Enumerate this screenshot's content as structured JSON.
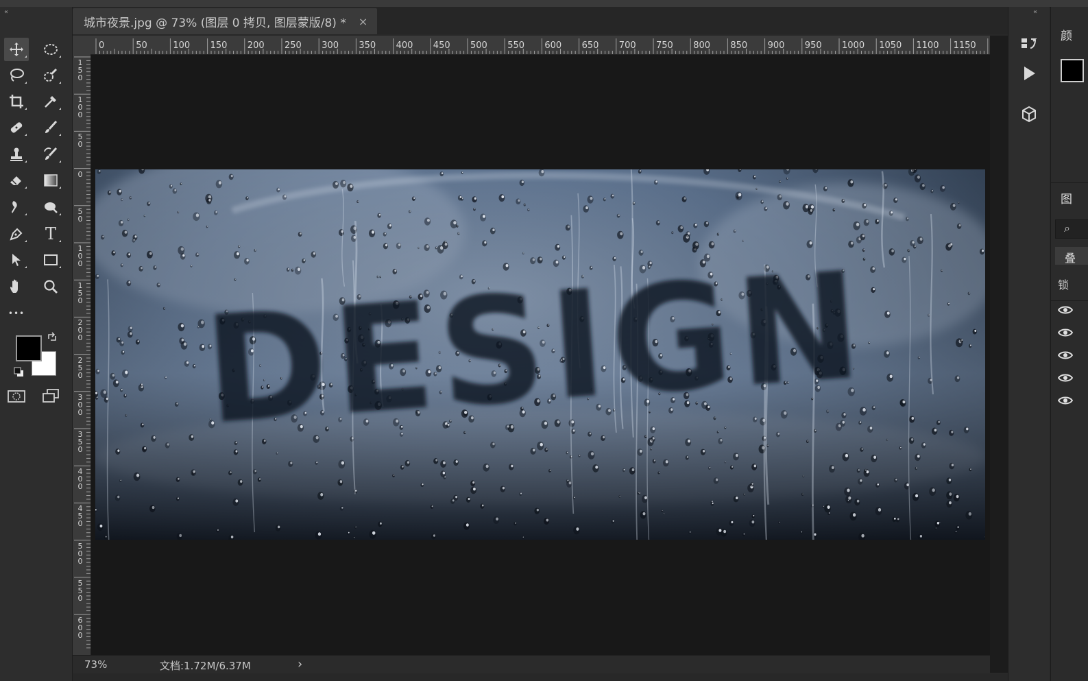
{
  "document": {
    "tab_title": "城市夜景.jpg @ 73% (图层 0 拷贝, 图层蒙版/8) *",
    "close_symbol": "×",
    "image_text": "DESIGN"
  },
  "toolbar": {
    "collapse_symbol": "‹‹",
    "tools": [
      {
        "name": "move-tool",
        "icon": "move-icon"
      },
      {
        "name": "elliptical-marquee-tool",
        "icon": "ellipse-marquee-icon"
      },
      {
        "name": "lasso-tool",
        "icon": "lasso-icon"
      },
      {
        "name": "quick-selection-tool",
        "icon": "quick-selection-icon"
      },
      {
        "name": "crop-tool",
        "icon": "crop-icon"
      },
      {
        "name": "eyedropper-tool",
        "icon": "eyedropper-icon"
      },
      {
        "name": "healing-brush-tool",
        "icon": "bandage-icon"
      },
      {
        "name": "brush-tool",
        "icon": "brush-icon"
      },
      {
        "name": "clone-stamp-tool",
        "icon": "stamp-icon"
      },
      {
        "name": "history-brush-tool",
        "icon": "history-brush-icon"
      },
      {
        "name": "eraser-tool",
        "icon": "eraser-icon"
      },
      {
        "name": "gradient-tool",
        "icon": "gradient-icon"
      },
      {
        "name": "blur-tool",
        "icon": "drop-icon"
      },
      {
        "name": "dodge-tool",
        "icon": "dodge-icon"
      },
      {
        "name": "pen-tool",
        "icon": "pen-icon"
      },
      {
        "name": "type-tool",
        "icon": "type-icon"
      },
      {
        "name": "path-selection-tool",
        "icon": "arrow-icon"
      },
      {
        "name": "rectangle-tool",
        "icon": "rectangle-icon"
      },
      {
        "name": "hand-tool",
        "icon": "hand-icon"
      },
      {
        "name": "zoom-tool",
        "icon": "zoom-icon"
      },
      {
        "name": "more-tools",
        "icon": "ellipsis-icon"
      }
    ],
    "type_glyph": "T",
    "more_glyph": "•••",
    "foreground_color": "#000000",
    "background_color": "#ffffff"
  },
  "rulers": {
    "horizontal": [
      "0",
      "50",
      "100",
      "150",
      "200",
      "250",
      "300",
      "350",
      "400",
      "450",
      "500",
      "550",
      "600",
      "650",
      "700",
      "750",
      "800",
      "850",
      "900",
      "950",
      "1000",
      "1050",
      "1100",
      "1150"
    ],
    "vertical": [
      "150",
      "100",
      "50",
      "0",
      "50",
      "100",
      "150",
      "200",
      "250",
      "300",
      "350",
      "400",
      "450",
      "500",
      "550",
      "600"
    ]
  },
  "status": {
    "zoom": "73%",
    "doc_info": "文档:1.72M/6.37M",
    "arrow": "›"
  },
  "right_panel": {
    "collapse_symbol": "‹‹",
    "color_label": "颜",
    "layers_label": "图",
    "blend_label": "叠",
    "lock_label": "锁",
    "search_symbol": "⌕",
    "layer_visibility_count": 5
  }
}
